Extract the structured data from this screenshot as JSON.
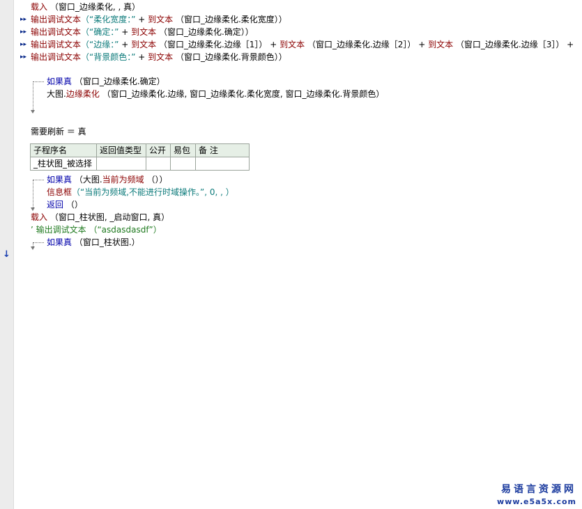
{
  "code": {
    "line1": {
      "kw": "载入",
      "args": " （窗口_边缘柔化, , 真）"
    },
    "line2": {
      "kw": "输出调试文本",
      "str": "（“柔化宽度：”",
      "op": " + ",
      "fn": "到文本",
      "arg": " （窗口_边缘柔化.柔化宽度））"
    },
    "line3": {
      "kw": "输出调试文本",
      "str": "（“确定：”",
      "op": " + ",
      "fn": "到文本",
      "arg": " （窗口_边缘柔化.确定））"
    },
    "line4": {
      "kw": "输出调试文本",
      "str": "（“边缘：”",
      "op1": " + ",
      "fn1": "到文本",
      "arg1": " （窗口_边缘柔化.边缘［1］）",
      "op2": " + ",
      "fn2": "到文本",
      "arg2": " （窗口_边缘柔化.边缘［2］）",
      "op3": " + ",
      "fn3": "到文本",
      "arg3": " （窗口_边缘柔化.边缘［3］）",
      "op4": " +"
    },
    "line5": {
      "kw": "输出调试文本",
      "str": "（“背景颜色：”",
      "op": " + ",
      "fn": "到文本",
      "arg": " （窗口_边缘柔化.背景颜色））"
    },
    "line6": {
      "kw": "如果真",
      "args": " （窗口_边缘柔化.确定）"
    },
    "line7": {
      "obj": "大图.",
      "fn": "边缘柔化",
      "args": " （窗口_边缘柔化.边缘, 窗口_边缘柔化.柔化宽度, 窗口_边缘柔化.背景颜色）"
    },
    "line8": {
      "text": "需要刷新 ＝ 真"
    },
    "line9": {
      "kw": "如果真",
      "obj": " （大图.",
      "fn": "当前为频域",
      "args": " （））"
    },
    "line10": {
      "kw": "信息框",
      "str": "（“当前为频域,不能进行时域操作。”, 0, , ）"
    },
    "line11": {
      "kw": "返回",
      "args": " （）"
    },
    "line12": {
      "kw": "载入",
      "args": " （窗口_柱状图, _启动窗口, 真）"
    },
    "line13": {
      "text": "’ 输出调试文本 （“asdasdasdf”）"
    },
    "line14": {
      "kw": "如果真",
      "args": " （窗口_柱状图.）"
    }
  },
  "subtable": {
    "headers": [
      "子程序名",
      "返回值类型",
      "公开",
      "易包",
      "备 注"
    ],
    "row": [
      "_柱状图_被选择",
      "",
      "",
      "",
      ""
    ]
  },
  "watermark": {
    "line1": "易语言资源网",
    "line2": "www.e5a5x.com"
  },
  "marker_glyph": "▸▸",
  "cursor_glyph": "↓"
}
